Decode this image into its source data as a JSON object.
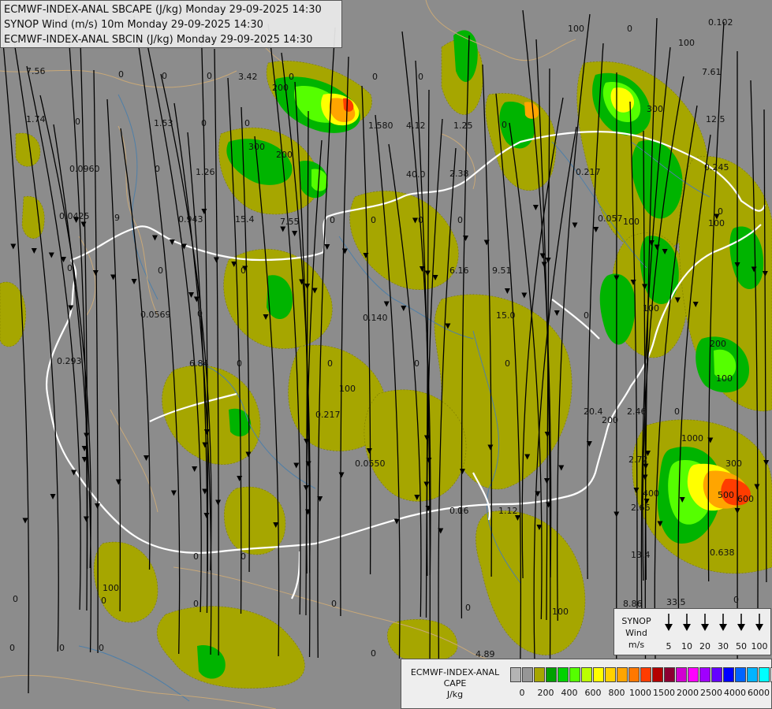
{
  "header": {
    "line1": "ECMWF-INDEX-ANAL SBCAPE (J/kg) Monday 29-09-2025 14:30",
    "line2": "SYNOP Wind (m/s) 10m Monday 29-09-2025 14:30",
    "line3": "ECMWF-INDEX-ANAL SBCIN (J/kg) Monday 29-09-2025 14:30"
  },
  "colors": {
    "background": "#8c8c8c",
    "olive": "#a6a600",
    "yellowgreen": "#9acd32",
    "green": "#00b400",
    "lime": "#55ff00",
    "yellow": "#ffff00",
    "orange": "#ffa500",
    "red": "#ff3c00",
    "border": "#ffffff",
    "river": "#4f7fa8",
    "streamline": "#000000"
  },
  "wind_legend": {
    "title_line1": "SYNOP",
    "title_line2": "Wind",
    "title_line3": "m/s",
    "keys": [
      "5",
      "10",
      "20",
      "30",
      "50",
      "100"
    ]
  },
  "cape_legend": {
    "title_line1": "ECMWF-INDEX-ANAL",
    "title_line2": "CAPE",
    "title_line3": "J/kg",
    "swatch_colors": [
      "#b4b4b4",
      "#969696",
      "#a6a600",
      "#00a000",
      "#00d200",
      "#55ff00",
      "#bbff00",
      "#ffff00",
      "#ffd200",
      "#ffa500",
      "#ff7800",
      "#ff3c00",
      "#b40000",
      "#8c0032",
      "#d200d2",
      "#ff00ff",
      "#a000ff",
      "#6400ff",
      "#0000ff",
      "#0064ff",
      "#00b4ff",
      "#00ffff",
      "#ffffff"
    ],
    "ticks": [
      "0",
      "200",
      "400",
      "600",
      "800",
      "1000",
      "1500",
      "2000",
      "2500",
      "4000",
      "6000"
    ]
  },
  "map_labels": [
    {
      "t": "7.56"
    },
    {
      "t": "0"
    },
    {
      "t": "0"
    },
    {
      "t": "0"
    },
    {
      "t": "3.42"
    },
    {
      "t": "0"
    },
    {
      "t": "0"
    },
    {
      "t": "0"
    },
    {
      "t": "0"
    },
    {
      "t": "0.102"
    },
    {
      "t": "1.74"
    },
    {
      "t": "0"
    },
    {
      "t": "1.53"
    },
    {
      "t": "0"
    },
    {
      "t": "0"
    },
    {
      "t": "1.580"
    },
    {
      "t": "4.12"
    },
    {
      "t": "1.25"
    },
    {
      "t": "0"
    },
    {
      "t": "7.61"
    },
    {
      "t": "0.0960"
    },
    {
      "t": "0"
    },
    {
      "t": "1.26"
    },
    {
      "t": "40.0"
    },
    {
      "t": "2.38"
    },
    {
      "t": "0.217"
    },
    {
      "t": "12.5"
    },
    {
      "t": "0.245"
    },
    {
      "t": "0.0425"
    },
    {
      "t": "9"
    },
    {
      "t": "0.943"
    },
    {
      "t": "15.4"
    },
    {
      "t": "7.55"
    },
    {
      "t": "0"
    },
    {
      "t": "0"
    },
    {
      "t": "0"
    },
    {
      "t": "0"
    },
    {
      "t": "0.057"
    },
    {
      "t": "0"
    },
    {
      "t": "0"
    },
    {
      "t": "6.16"
    },
    {
      "t": "9.51"
    },
    {
      "t": "0"
    },
    {
      "t": "0"
    },
    {
      "t": "0.0569"
    },
    {
      "t": "0"
    },
    {
      "t": "0.140"
    },
    {
      "t": "15.0"
    },
    {
      "t": "0"
    },
    {
      "t": "0.293"
    },
    {
      "t": "6.84"
    },
    {
      "t": "0"
    },
    {
      "t": "0"
    },
    {
      "t": "0"
    },
    {
      "t": "0"
    },
    {
      "t": "0.217"
    },
    {
      "t": "20.4"
    },
    {
      "t": "2.46"
    },
    {
      "t": "0"
    },
    {
      "t": "0.0550"
    },
    {
      "t": "2.72"
    },
    {
      "t": "0"
    },
    {
      "t": "0.16"
    },
    {
      "t": "1.12"
    },
    {
      "t": "2.66"
    },
    {
      "t": "0"
    },
    {
      "t": "0"
    },
    {
      "t": "13.4"
    },
    {
      "t": "0.638"
    },
    {
      "t": "0"
    },
    {
      "t": "0"
    },
    {
      "t": "0"
    },
    {
      "t": "0"
    },
    {
      "t": "8.86"
    },
    {
      "t": "33.5"
    },
    {
      "t": "0"
    },
    {
      "t": "0"
    },
    {
      "t": "0"
    },
    {
      "t": "0"
    },
    {
      "t": "0"
    },
    {
      "t": "4.89"
    },
    {
      "t": "0"
    },
    {
      "t": "200"
    },
    {
      "t": "300"
    },
    {
      "t": "200"
    },
    {
      "t": "300"
    },
    {
      "t": "200"
    },
    {
      "t": "100"
    },
    {
      "t": "100"
    },
    {
      "t": "100"
    },
    {
      "t": "100"
    },
    {
      "t": "100"
    },
    {
      "t": "100"
    },
    {
      "t": "200"
    },
    {
      "t": "300"
    },
    {
      "t": "400"
    },
    {
      "t": "500"
    },
    {
      "t": "600"
    },
    {
      "t": "1000"
    },
    {
      "t": "100"
    },
    {
      "t": "100"
    },
    {
      "t": "100"
    }
  ]
}
